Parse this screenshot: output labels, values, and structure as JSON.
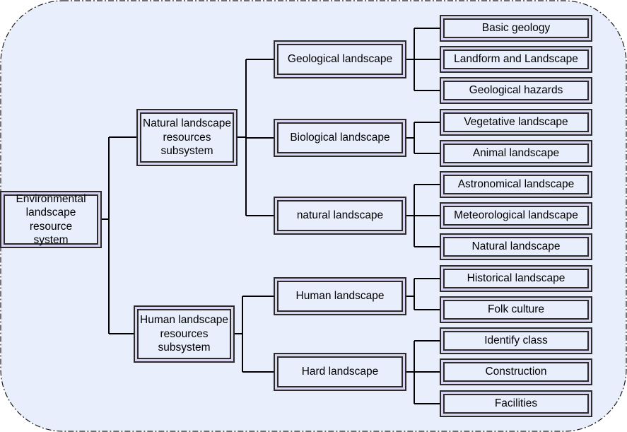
{
  "diagram": {
    "type": "tree",
    "colors": {
      "background": "#e8eefc",
      "box_outer_fill": "#d9d4f0",
      "box_inner_fill": "#e8eefc",
      "border": "#2b2b2b",
      "connector": "#000000"
    },
    "root": {
      "label": "Environmental landscape resource system",
      "lines": [
        "Environmental",
        "landscape",
        "resource system"
      ]
    },
    "subsystems": [
      {
        "label": "Natural landscape resources subsystem",
        "lines": [
          "Natural landscape",
          "resources",
          "subsystem"
        ],
        "categories": [
          {
            "label": "Geological landscape",
            "leaves": [
              "Basic geology",
              "Landform and Landscape",
              "Geological hazards"
            ]
          },
          {
            "label": "Biological landscape",
            "leaves": [
              "Vegetative landscape",
              "Animal landscape"
            ]
          },
          {
            "label": "natural landscape",
            "leaves": [
              "Astronomical landscape",
              "Meteorological landscape",
              "Natural landscape"
            ]
          }
        ]
      },
      {
        "label": "Human landscape resources subsystem",
        "lines": [
          "Human landscape",
          "resources",
          "subsystem"
        ],
        "categories": [
          {
            "label": "Human landscape",
            "leaves": [
              "Historical landscape",
              "Folk culture"
            ]
          },
          {
            "label": "Hard landscape",
            "leaves": [
              "Identify class",
              "Construction",
              "Facilities"
            ]
          }
        ]
      }
    ]
  }
}
